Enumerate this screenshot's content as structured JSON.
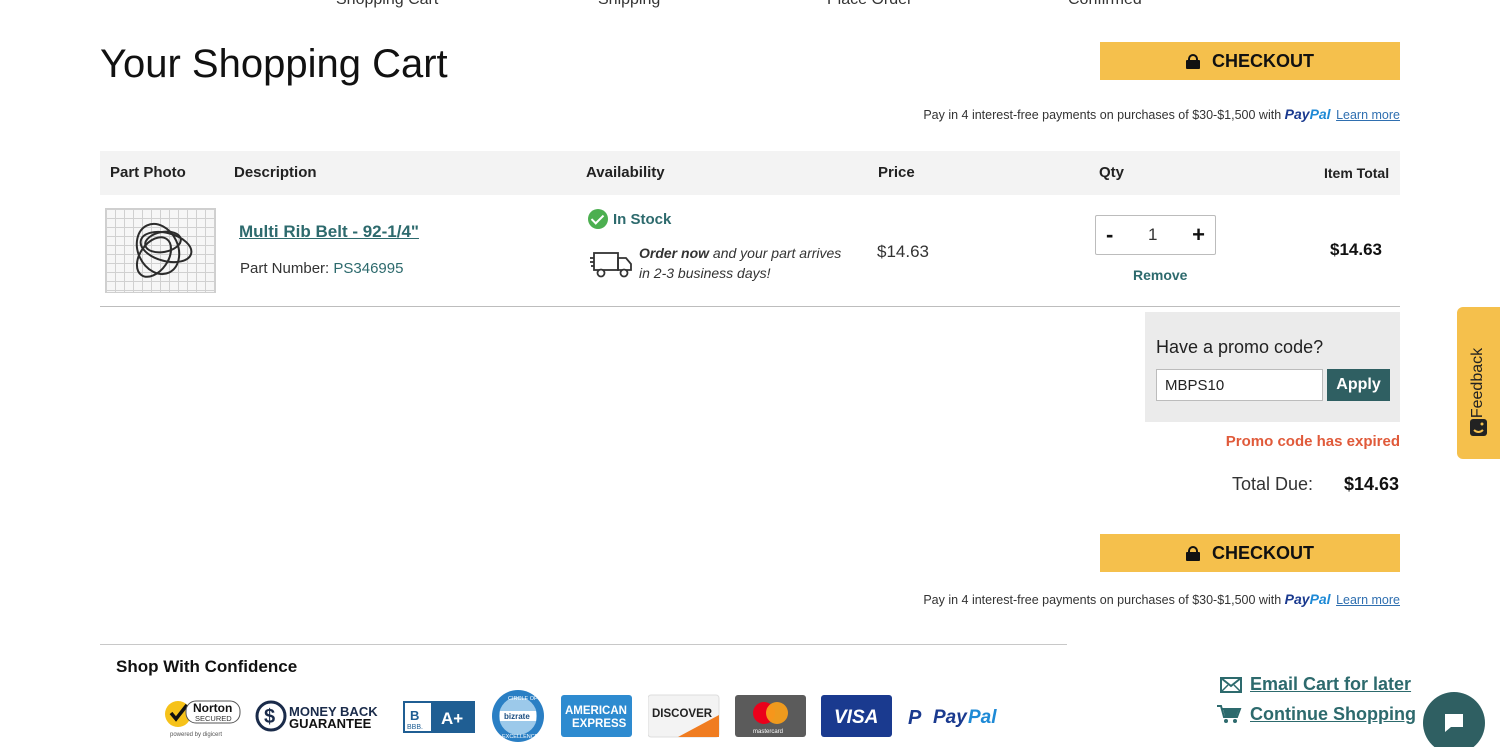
{
  "progress_steps": [
    "Shopping Cart",
    "Shipping",
    "Place Order",
    "Confirmed"
  ],
  "page_title": "Your Shopping Cart",
  "checkout_label": "CHECKOUT",
  "paypal_promo": {
    "text": "Pay in 4 interest-free payments on purchases of $30-$1,500 with",
    "logo_a": "Pay",
    "logo_b": "Pal",
    "learn_more": "Learn more"
  },
  "table_headers": {
    "photo": "Part Photo",
    "description": "Description",
    "availability": "Availability",
    "price": "Price",
    "qty": "Qty",
    "item_total": "Item Total"
  },
  "item": {
    "name": "Multi Rib Belt - 92-1/4\"",
    "part_number_label": "Part Number:",
    "part_number": "PS346995",
    "stock_status": "In Stock",
    "order_now": "Order now",
    "arrival_rest": " and your part arrives",
    "arrival_line2": "in 2-3 business days!",
    "price": "$14.63",
    "qty_minus": "-",
    "qty": "1",
    "qty_plus": "+",
    "remove": "Remove",
    "item_total": "$14.63"
  },
  "promo": {
    "label": "Have a promo code?",
    "value": "MBPS10",
    "apply": "Apply",
    "error": "Promo code has expired"
  },
  "total": {
    "label": "Total Due:",
    "value": "$14.63"
  },
  "confidence": {
    "title": "Shop With Confidence",
    "badges": {
      "norton_1": "Norton",
      "norton_2": "SECURED",
      "norton_3": "powered by digicert",
      "money_back_1": "MONEY BACK",
      "money_back_2": "GUARANTEE",
      "bbb_rating": "A+",
      "bbb_small": "BBB.",
      "bizrate_top": "CIRCLE OF",
      "bizrate_mid": "bizrate",
      "bizrate_bottom": "EXCELLENCE",
      "amex_1": "AMERICAN",
      "amex_2": "EXPRESS",
      "discover": "DISCOVER",
      "mastercard": "mastercard",
      "visa": "VISA",
      "paypal_a": "Pay",
      "paypal_b": "Pal"
    }
  },
  "links": {
    "email_cart": "Email Cart for later",
    "continue_shopping": "Continue Shopping"
  },
  "feedback_label": "Feedback",
  "colors": {
    "accent": "#f5c04c",
    "teal": "#2d6a6d",
    "error": "#e05a3a",
    "success": "#4caf50"
  },
  "icons": [
    "lock-icon",
    "check-circle-icon",
    "truck-icon",
    "envelope-icon",
    "cart-icon",
    "chat-icon",
    "feedback-face-icon"
  ]
}
